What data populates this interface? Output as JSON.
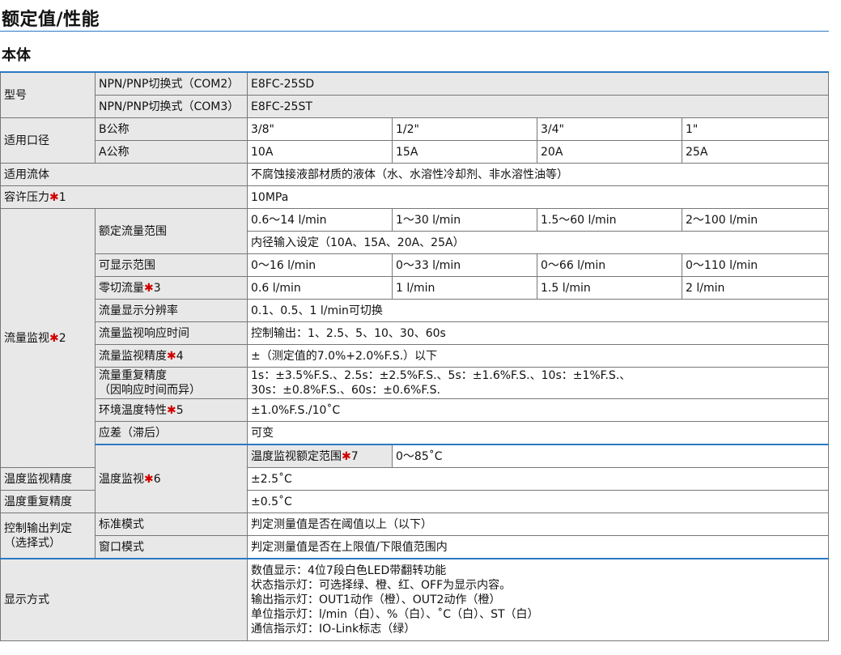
{
  "heading": "额定值/性能",
  "subheading": "本体",
  "rows": {
    "model_label": "型号",
    "model_com2_label": "NPN/PNP切换式（COM2）",
    "model_com2_value": "E8FC-25SD",
    "model_com3_label": "NPN/PNP切换式（COM3）",
    "model_com3_value": "E8FC-25ST",
    "bore_label": "适用口径",
    "b_nominal_label": "B公称",
    "b_nominal": [
      "3/8\"",
      "1/2\"",
      "3/4\"",
      "1\""
    ],
    "a_nominal_label": "A公称",
    "a_nominal": [
      "10A",
      "15A",
      "20A",
      "25A"
    ],
    "fluid_label": "适用流体",
    "fluid_value": "不腐蚀接液部材质的液体（水、水溶性冷却剂、非水溶性油等）",
    "pressure_label": "容许压力",
    "pressure_note": "1",
    "pressure_value": "10MPa",
    "flow_label": "流量监视",
    "flow_note": "2",
    "rated_flow_label": "额定流量范围",
    "rated_flow": [
      "0.6～14 l/min",
      "1～30 l/min",
      "1.5～60 l/min",
      "2～100 l/min"
    ],
    "rated_flow_setting": "内径输入设定（10A、15A、20A、25A）",
    "display_range_label": "可显示范围",
    "display_range": [
      "0～16 l/min",
      "0～33 l/min",
      "0～66 l/min",
      "0～110 l/min"
    ],
    "zero_cut_label": "零切流量",
    "zero_cut_note": "3",
    "zero_cut": [
      "0.6 l/min",
      "1 l/min",
      "1.5 l/min",
      "2 l/min"
    ],
    "resolution_label": "流量显示分辨率",
    "resolution_value": "0.1、0.5、1 l/min可切换",
    "response_label": "流量监视响应时间",
    "response_value": "控制输出：1、2.5、5、10、30、60s",
    "accuracy_label": "流量监视精度",
    "accuracy_note": "4",
    "accuracy_value": "±（测定值的7.0%+2.0%F.S.）以下",
    "repeat_label_1": "流量重复精度",
    "repeat_label_2": "（因响应时间而异）",
    "repeat_value_1": "1s：±3.5%F.S.、2.5s：±2.5%F.S.、5s：±1.6%F.S.、10s：±1%F.S.、",
    "repeat_value_2": "30s：±0.8%F.S.、60s：±0.6%F.S.",
    "temp_char_label": "环境温度特性",
    "temp_char_note": "5",
    "temp_char_value": "±1.0%F.S./10˚C",
    "hysteresis_label": "应差（滞后）",
    "hysteresis_value": "可变",
    "temp_mon_label": "温度监视",
    "temp_mon_note": "6",
    "temp_rated_label": "温度监视额定范围",
    "temp_rated_note": "7",
    "temp_rated_value": "0～85˚C",
    "temp_acc_label": "温度监视精度",
    "temp_acc_value": "±2.5˚C",
    "temp_rep_label": "温度重复精度",
    "temp_rep_value": "±0.5˚C",
    "ctrl_label_1": "控制输出判定",
    "ctrl_label_2": "（选择式）",
    "std_mode_label": "标准模式",
    "std_mode_value": "判定测量值是否在阈值以上（以下）",
    "win_mode_label": "窗口模式",
    "win_mode_value": "判定测量值是否在上限值/下限值范围内",
    "display_label": "显示方式",
    "display_lines": [
      "数值显示：4位7段白色LED带翻转功能",
      "状态指示灯：可选择绿、橙、红、OFF为显示内容。",
      "输出指示灯：OUT1动作（橙）、OUT2动作（橙）",
      "单位指示灯：l/min（白）、%（白）、˚C（白）、ST（白）",
      "通信指示灯：IO-Link标志（绿）"
    ]
  },
  "colors": {
    "accent_rule": "#2b79c4",
    "note_mark": "#d00000",
    "label_bg": "#e8e8e8"
  }
}
